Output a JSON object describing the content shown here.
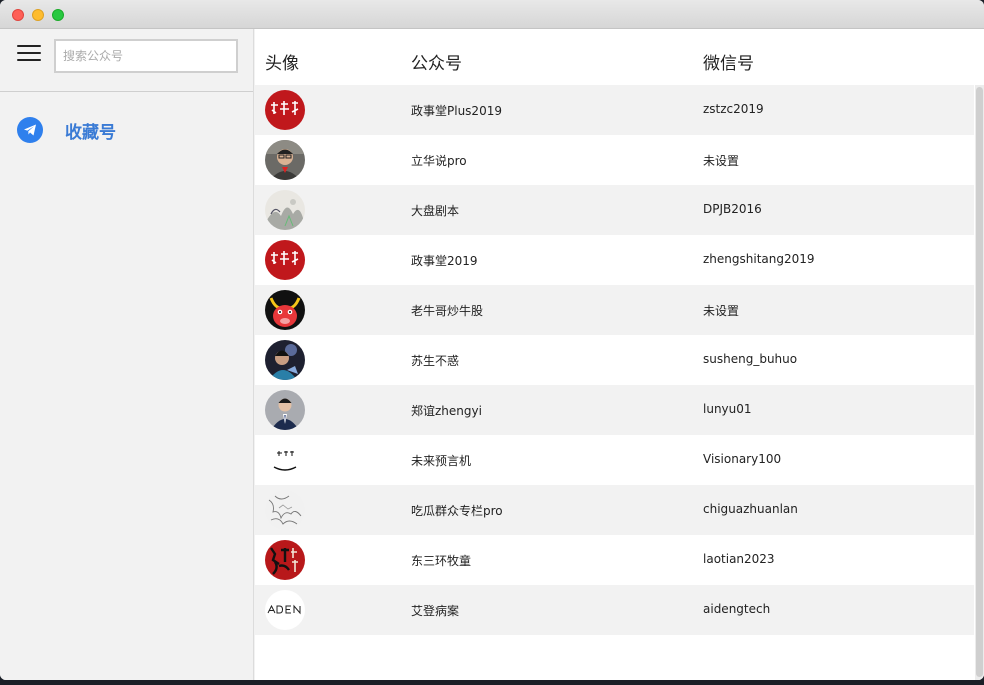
{
  "sidebar": {
    "search_placeholder": "搜索公众号",
    "nav_label": "收藏号"
  },
  "table": {
    "headers": {
      "avatar": "头像",
      "name": "公众号",
      "wechat_id": "微信号"
    },
    "rows": [
      {
        "name": "政事堂Plus2019",
        "wechat_id": "zstzc2019",
        "avatar": "red-calligraphy"
      },
      {
        "name": "立华说pro",
        "wechat_id": "未设置",
        "avatar": "photo-man-glasses"
      },
      {
        "name": "大盘剧本",
        "wechat_id": "DPJB2016",
        "avatar": "ink-painting"
      },
      {
        "name": "政事堂2019",
        "wechat_id": "zhengshitang2019",
        "avatar": "red-calligraphy"
      },
      {
        "name": "老牛哥炒牛股",
        "wechat_id": "未设置",
        "avatar": "red-bull-cartoon"
      },
      {
        "name": "苏生不惑",
        "wechat_id": "susheng_buhuo",
        "avatar": "photo-dark"
      },
      {
        "name": "郑谊zhengyi",
        "wechat_id": "lunyu01",
        "avatar": "photo-man-suit"
      },
      {
        "name": "未来预言机",
        "wechat_id": "Visionary100",
        "avatar": "white-smile"
      },
      {
        "name": "吃瓜群众专栏pro",
        "wechat_id": "chiguazhuanlan",
        "avatar": "sketch"
      },
      {
        "name": "东三环牧童",
        "wechat_id": "laotian2023",
        "avatar": "red-black-calligraphy"
      },
      {
        "name": "艾登病案",
        "wechat_id": "aidengtech",
        "avatar": "aden-logo"
      }
    ]
  },
  "colors": {
    "accent": "#3a7bd5",
    "nav_icon": "#2f80ed",
    "seal_red": "#c0181c"
  }
}
